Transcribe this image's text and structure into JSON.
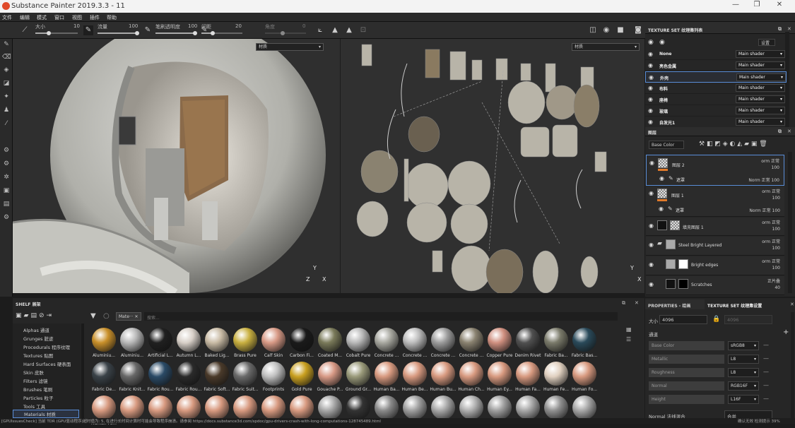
{
  "window": {
    "title": "Substance Painter 2019.3.3 - 11",
    "min": "—",
    "max": "❐",
    "close": "✕"
  },
  "menu": [
    "文件",
    "编辑",
    "模式",
    "窗口",
    "视图",
    "插件",
    "帮助"
  ],
  "toolbar": {
    "size_label": "大小",
    "size_value": "10",
    "flow_label": "流量",
    "flow_value": "100",
    "stroke_opacity_label": "笔刷透明度",
    "stroke_opacity_value": "100",
    "spacing_label": "间距",
    "spacing_value": "20",
    "angle_label": "角度",
    "angle_value": "0"
  },
  "viewport3d": {
    "channel": "材质",
    "axis_up": "Y",
    "axis_z": "Z",
    "axis_x": "X"
  },
  "viewport2d": {
    "channel": "材质",
    "axis_up": "Y",
    "axis_x": "X"
  },
  "texture_set_list": {
    "title": "TEXTURE SET 纹理集列表",
    "settings_label": "设置",
    "rows": [
      {
        "name": "None",
        "shader": "Main shader"
      },
      {
        "name": "亮色金属",
        "shader": "Main shader"
      },
      {
        "name": "外壳",
        "shader": "Main shader"
      },
      {
        "name": "布料",
        "shader": "Main shader"
      },
      {
        "name": "座椅",
        "shader": "Main shader"
      },
      {
        "name": "玻璃",
        "shader": "Main shader"
      },
      {
        "name": "自发光1",
        "shader": "Main shader"
      }
    ]
  },
  "layers": {
    "title": "图层",
    "channel": "Base Color",
    "items": [
      {
        "name": "图层 2",
        "blend": "orm 正常",
        "opacity": "100"
      },
      {
        "name": "遮罩",
        "blend": "Norm 正常",
        "opacity": "100"
      },
      {
        "name": "图层 1",
        "blend": "orm 正常",
        "opacity": "100"
      },
      {
        "name": "遮罩",
        "blend": "Norm 正常",
        "opacity": "100"
      },
      {
        "name": "填充图层 1",
        "blend": "orm 正常",
        "opacity": "100"
      },
      {
        "name": "Steel Bright Layered",
        "blend": "orm 正常",
        "opacity": "100"
      },
      {
        "name": "Bright edges",
        "blend": "orm 正常",
        "opacity": "100"
      },
      {
        "name": "Scratches",
        "blend": "正片叠",
        "opacity": "40"
      }
    ]
  },
  "shelf": {
    "title": "SHELF 展架",
    "filter_tag": "Mate···",
    "search_placeholder": "搜索...",
    "categories": [
      "Alphas 通道",
      "Grunges 脏迹",
      "Procedurals 程序纹理",
      "Textures 贴图",
      "Hard Surfaces 硬表面",
      "Skin 皮肤",
      "Filters 滤镜",
      "Brushes 笔刷",
      "Particles 粒子",
      "Tools 工具",
      "Materials 材质"
    ],
    "selected_category": "Materials 材质",
    "materials": [
      {
        "name": "Aluminiu...",
        "color": "#c9902a"
      },
      {
        "name": "Aluminiu...",
        "color": "#b8b8b8"
      },
      {
        "name": "Artificial L...",
        "color": "#202020"
      },
      {
        "name": "Autumn L...",
        "color": "#d8d0c8"
      },
      {
        "name": "Baked Lig...",
        "color": "#c9bba5"
      },
      {
        "name": "Brass Pure",
        "color": "#c9b040"
      },
      {
        "name": "Calf Skin",
        "color": "#d89a86"
      },
      {
        "name": "Carbon Fi...",
        "color": "#1a1a1a"
      },
      {
        "name": "Coated M...",
        "color": "#7a7a5a"
      },
      {
        "name": "Cobalt Pure",
        "color": "#b8b8b8"
      },
      {
        "name": "Concrete ...",
        "color": "#a8a8a0"
      },
      {
        "name": "Concrete ...",
        "color": "#bcbcbc"
      },
      {
        "name": "Concrete ...",
        "color": "#9c9c9c"
      },
      {
        "name": "Concrete ...",
        "color": "#8a8270"
      },
      {
        "name": "Copper Pure",
        "color": "#d09080"
      },
      {
        "name": "Denim Rivet",
        "color": "#505050"
      },
      {
        "name": "Fabric Ba...",
        "color": "#7a7a6a"
      },
      {
        "name": "Fabric Bas...",
        "color": "#2a4a5a"
      },
      {
        "name": "Fabric De...",
        "color": "#3a4248"
      },
      {
        "name": "Fabric Knit...",
        "color": "#686868"
      },
      {
        "name": "Fabric Rou...",
        "color": "#2a4a66"
      },
      {
        "name": "Fabric Rou...",
        "color": "#2a2a2a"
      },
      {
        "name": "Fabric Soft...",
        "color": "#4a3a2a"
      },
      {
        "name": "Fabric Suit...",
        "color": "#6a6a6a"
      },
      {
        "name": "Footprints",
        "color": "#c0c0c0"
      },
      {
        "name": "Gold Pure",
        "color": "#c9a020"
      },
      {
        "name": "Gouache P...",
        "color": "#d89a86"
      },
      {
        "name": "Ground Gr...",
        "color": "#9a9a7a"
      },
      {
        "name": "Human Ba...",
        "color": "#d89a80"
      },
      {
        "name": "Human Be...",
        "color": "#d89a80"
      },
      {
        "name": "Human Bu...",
        "color": "#d89a80"
      },
      {
        "name": "Human Ch...",
        "color": "#d89a80"
      },
      {
        "name": "Human Ey...",
        "color": "#d89a80"
      },
      {
        "name": "Human Fa...",
        "color": "#d89a80"
      },
      {
        "name": "Human Fe...",
        "color": "#e0d0c0"
      },
      {
        "name": "Human Fo...",
        "color": "#d89a80"
      },
      {
        "name": "Human Fo...",
        "color": "#d89a80"
      },
      {
        "name": "",
        "color": "#d89a80"
      },
      {
        "name": "",
        "color": "#d89a80"
      },
      {
        "name": "",
        "color": "#d89a80"
      },
      {
        "name": "",
        "color": "#d89a80"
      },
      {
        "name": "",
        "color": "#d89a80"
      },
      {
        "name": "",
        "color": "#d89a80"
      },
      {
        "name": "",
        "color": "#d89a80"
      },
      {
        "name": "",
        "color": "#a8a8a8"
      },
      {
        "name": "",
        "color": "#333333"
      },
      {
        "name": "",
        "color": "#8a8a8a"
      },
      {
        "name": "",
        "color": "#a0a0a0"
      },
      {
        "name": "",
        "color": "#a8a8a8"
      },
      {
        "name": "",
        "color": "#b0b0b0"
      },
      {
        "name": "",
        "color": "#a0a0a0"
      },
      {
        "name": "",
        "color": "#a8a8a8"
      },
      {
        "name": "",
        "color": "#909090"
      },
      {
        "name": "",
        "color": "#a8a8a8"
      }
    ]
  },
  "properties": {
    "tab1": "PROPERTIES - 绘画",
    "tab2": "TEXTURE SET 纹理集设置",
    "size_label": "大小",
    "size_value": "4096",
    "size_readonly": "4096",
    "channels_label": "通道",
    "channels": [
      {
        "name": "Base Color",
        "format": "sRGB8"
      },
      {
        "name": "Metallic",
        "format": "L8"
      },
      {
        "name": "Roughness",
        "format": "L8"
      },
      {
        "name": "Normal",
        "format": "RGB16F"
      },
      {
        "name": "Height",
        "format": "L16F"
      }
    ],
    "normal_mix_label": "Normal 法线混合",
    "normal_mix_value": "合并"
  },
  "status": {
    "text": "[GPUIssuesCheck] 当前 TDR (GPU驱动程序)超时值为: 5, 在进行长时间计算时可能会导致程序崩溃。请参阅 https://docs.substance3d.com/spdoc/gpu-drivers-crash-with-long-computations-128745489.html",
    "right": "确认无效 检测提示 39%"
  }
}
